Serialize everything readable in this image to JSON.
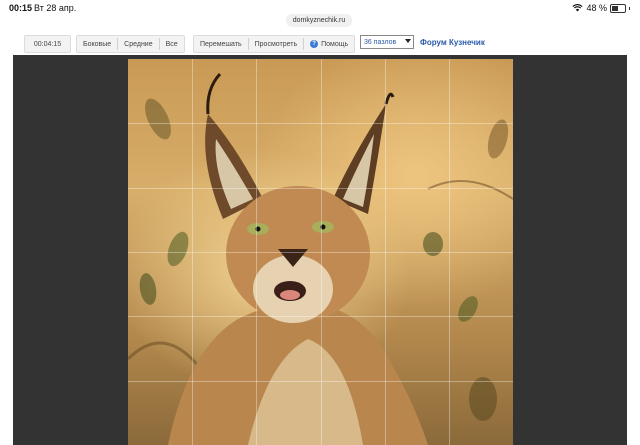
{
  "status_bar": {
    "time": "00:15",
    "date": "Вт 28 апр.",
    "battery": "48 %",
    "battery_level": 0.48
  },
  "browser": {
    "url": "domkyznechik.ru"
  },
  "toolbar": {
    "timer": "00:04:15",
    "edge_label": "Боковые",
    "middle_label": "Средние",
    "all_label": "Все",
    "shuffle_label": "Перемешать",
    "preview_label": "Просмотреть",
    "help_label": "Помощь",
    "pieces_select": "36 пазлов",
    "forum_link": "Форум Кузнечик"
  },
  "puzzle": {
    "columns": 6,
    "rows": 6,
    "image_subject": "caracal"
  },
  "colors": {
    "link": "#2a5aa8",
    "board": "#333333",
    "help_icon": "#3a7bd5"
  }
}
